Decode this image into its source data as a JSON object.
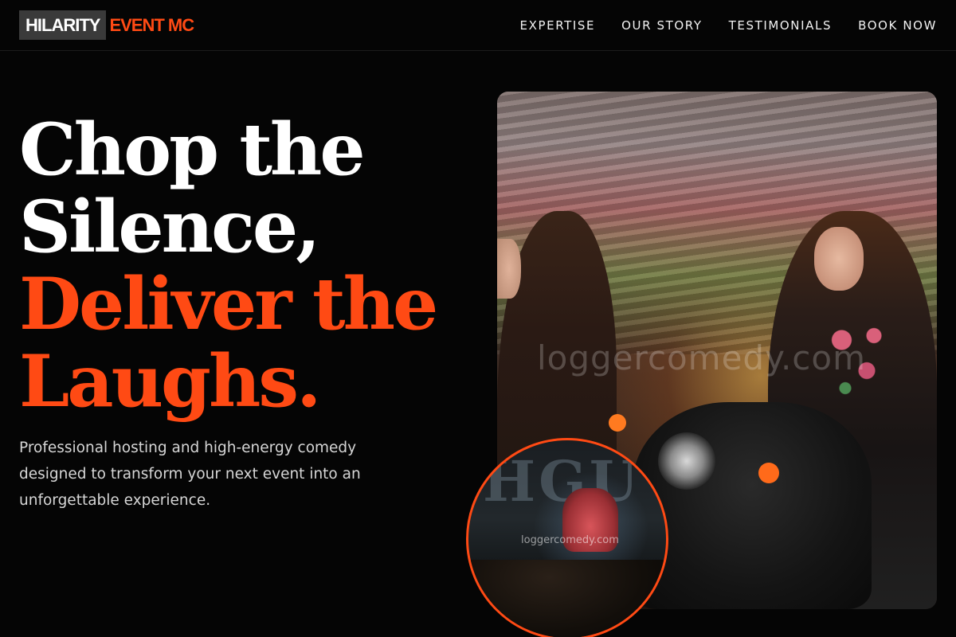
{
  "brand": {
    "name": "HILARITY",
    "accent": "EVENT MC",
    "accent_color": "#ff4a14"
  },
  "nav": {
    "items": [
      {
        "label": "EXPERTISE"
      },
      {
        "label": "OUR STORY"
      },
      {
        "label": "TESTIMONIALS"
      },
      {
        "label": "BOOK NOW"
      }
    ]
  },
  "hero": {
    "title_lines": {
      "line1": "Chop the",
      "line2": "Silence,",
      "line3": "Deliver the",
      "line4": "Laughs."
    },
    "subtitle": "Professional hosting and high-energy comedy designed to transform your next event into an unforgettable experience."
  },
  "media": {
    "main_photo_watermark": "loggercomedy.com",
    "inset_watermark": "loggercomedy.com"
  }
}
